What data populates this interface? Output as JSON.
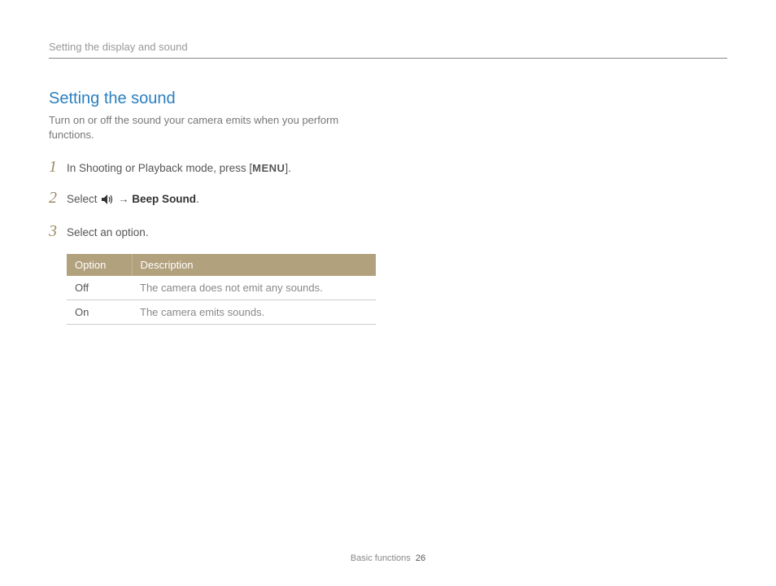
{
  "header": "Setting the display and sound",
  "section": {
    "title": "Setting the sound",
    "desc": "Turn on or off the sound your camera emits when you perform functions."
  },
  "steps": [
    {
      "num": "1",
      "prefix": "In Shooting or Playback mode, press [",
      "menu": "MENU",
      "suffix": "]."
    },
    {
      "num": "2",
      "prefix": "Select ",
      "arrow": " → ",
      "beep": "Beep Sound",
      "suffix": "."
    },
    {
      "num": "3",
      "text": "Select an option."
    }
  ],
  "table": {
    "headers": {
      "option": "Option",
      "description": "Description"
    },
    "rows": [
      {
        "opt": "Off",
        "desc": "The camera does not emit any sounds."
      },
      {
        "opt": "On",
        "desc": "The camera emits sounds."
      }
    ]
  },
  "footer": {
    "label": "Basic functions",
    "page": "26"
  }
}
